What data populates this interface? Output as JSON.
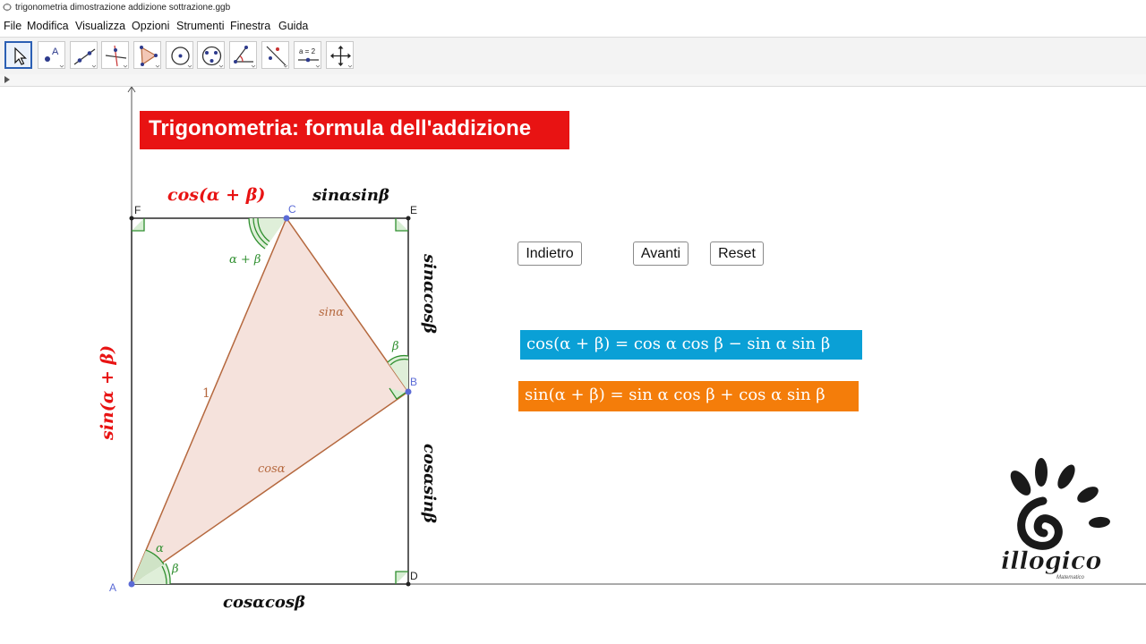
{
  "window": {
    "title": "trigonometria dimostrazione addizione sottrazione.ggb"
  },
  "menu": [
    "File",
    "Modifica",
    "Visualizza",
    "Opzioni",
    "Strumenti",
    "Finestra",
    "Guida"
  ],
  "toolbar": {
    "tools": [
      "move-tool-icon",
      "point-tool-icon",
      "line-tool-icon",
      "perpendicular-line-tool-icon",
      "polygon-tool-icon",
      "circle-tool-icon",
      "ellipse-tool-icon",
      "angle-tool-icon",
      "reflect-tool-icon",
      "slider-tool-icon",
      "move-view-tool-icon"
    ],
    "selected": "move-tool-icon",
    "slider_label": "a = 2"
  },
  "heading": "Trigonometria: formula dell'addizione",
  "buttons": {
    "back": "Indietro",
    "next": "Avanti",
    "reset": "Reset"
  },
  "formulas": {
    "cos_sum": "cos(α + β) = cos α cos β − sin α sin β",
    "sin_sum": "sin(α + β) = sin α cos β + cos α sin β"
  },
  "points": {
    "A": "A",
    "B": "B",
    "C": "C",
    "D": "D",
    "E": "E",
    "F": "F"
  },
  "labels": {
    "top_left": "cos(α + β)",
    "top_right": "sinαsinβ",
    "right_upper": "sinαcosβ",
    "right_lower": "cosαsinβ",
    "bottom": "cosαcosβ",
    "left": "sin(α + β)",
    "side_AC": "1",
    "side_CB": "sinα",
    "side_AB": "cosα",
    "angle_C": "α + β",
    "angle_B": "β",
    "angle_A_alpha": "α",
    "angle_A_beta": "β"
  },
  "logo": {
    "text": "illogico",
    "subtext": "Matematico"
  },
  "colors": {
    "heading_bg": "#e81313",
    "cos_formula_bg": "#0aa0d6",
    "sin_formula_bg": "#f47d0a",
    "triangle_fill": "#f5e2dc",
    "triangle_stroke": "#b5683e",
    "angle_green": "#2f8f2f",
    "label_red": "#e81313"
  }
}
